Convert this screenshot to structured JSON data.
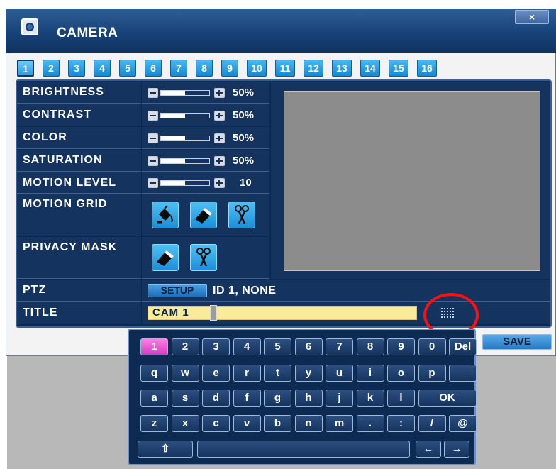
{
  "window": {
    "title": "CAMERA",
    "close_label": "×"
  },
  "channels": [
    "1",
    "2",
    "3",
    "4",
    "5",
    "6",
    "7",
    "8",
    "9",
    "10",
    "11",
    "12",
    "13",
    "14",
    "15",
    "16"
  ],
  "active_channel": "1",
  "settings": [
    {
      "label": "BRIGHTNESS",
      "value": "50%",
      "level": 0.5
    },
    {
      "label": "CONTRAST",
      "value": "50%",
      "level": 0.5
    },
    {
      "label": "COLOR",
      "value": "50%",
      "level": 0.5
    },
    {
      "label": "SATURATION",
      "value": "50%",
      "level": 0.5
    },
    {
      "label": "MOTION LEVEL",
      "value": "10",
      "level": 0.5
    }
  ],
  "motion_grid": {
    "label": "MOTION GRID",
    "tools": [
      "paint-bucket-icon",
      "eraser-icon",
      "scissors-icon"
    ]
  },
  "privacy_mask": {
    "label": "PRIVACY MASK",
    "tools": [
      "eraser-icon",
      "scissors-icon"
    ]
  },
  "ptz": {
    "label": "PTZ",
    "setup_label": "SETUP",
    "info": "ID 1, NONE"
  },
  "title_field": {
    "label": "TITLE",
    "value": "CAM  1"
  },
  "save_label": "SAVE",
  "keyboard": {
    "row1": [
      "1",
      "2",
      "3",
      "4",
      "5",
      "6",
      "7",
      "8",
      "9",
      "0",
      "Del"
    ],
    "row2": [
      "q",
      "w",
      "e",
      "r",
      "t",
      "y",
      "u",
      "i",
      "o",
      "p",
      "_"
    ],
    "row3": [
      "a",
      "s",
      "d",
      "f",
      "g",
      "h",
      "j",
      "k",
      "l",
      "OK"
    ],
    "row4": [
      "z",
      "x",
      "c",
      "v",
      "b",
      "n",
      "m",
      ".",
      ":",
      "/",
      "@"
    ],
    "row5": [
      "⇧",
      "",
      "←",
      "→"
    ]
  }
}
